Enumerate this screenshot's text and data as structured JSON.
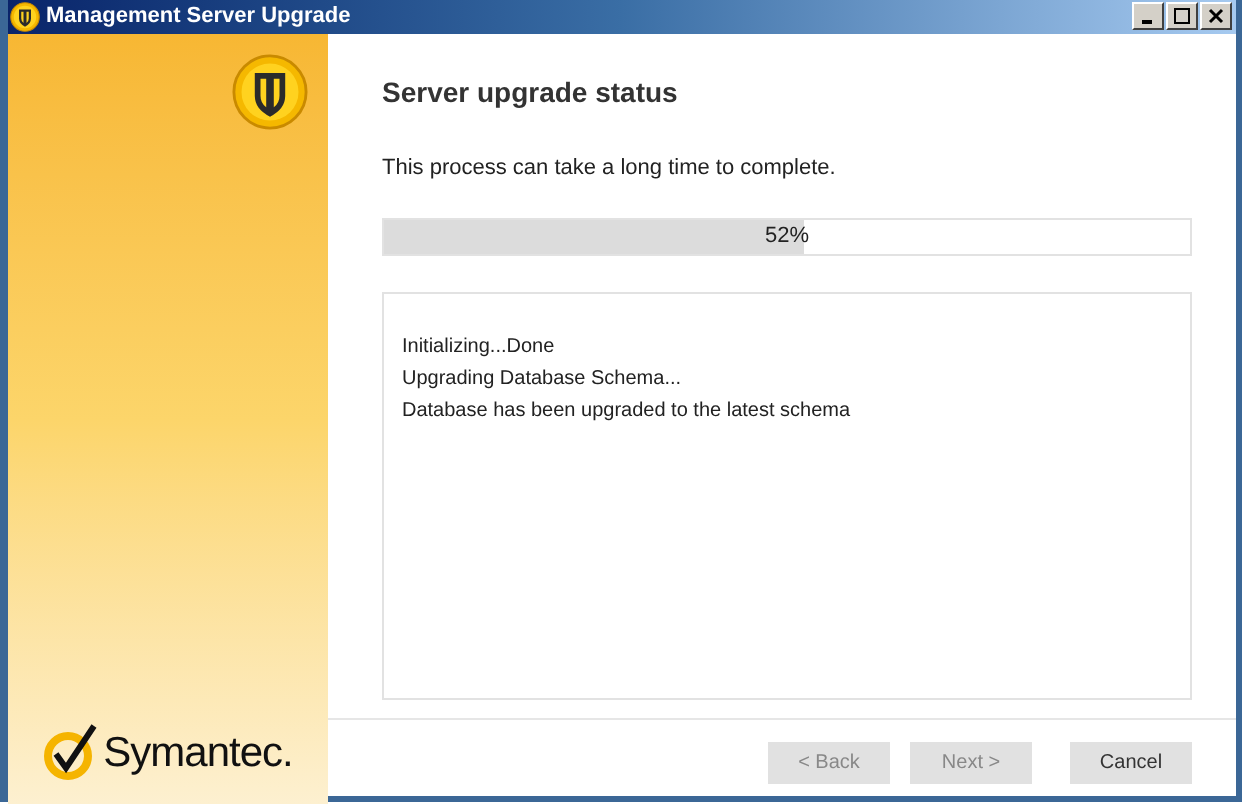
{
  "window": {
    "title": "Management Server Upgrade"
  },
  "brand": {
    "name": "Symantec."
  },
  "heading": "Server upgrade status",
  "description": "This process can take a long time to complete.",
  "progress": {
    "level": 0.52,
    "reading": "52%"
  },
  "log": [
    "Initializing...Done",
    "Upgrading Database Schema...",
    "Database has been upgraded to the latest schema"
  ],
  "buttons": [
    {
      "label": "< Back",
      "disabled": true
    },
    {
      "label": "Next >",
      "disabled": true
    },
    {
      "label": "Cancel",
      "disabled": false
    }
  ]
}
